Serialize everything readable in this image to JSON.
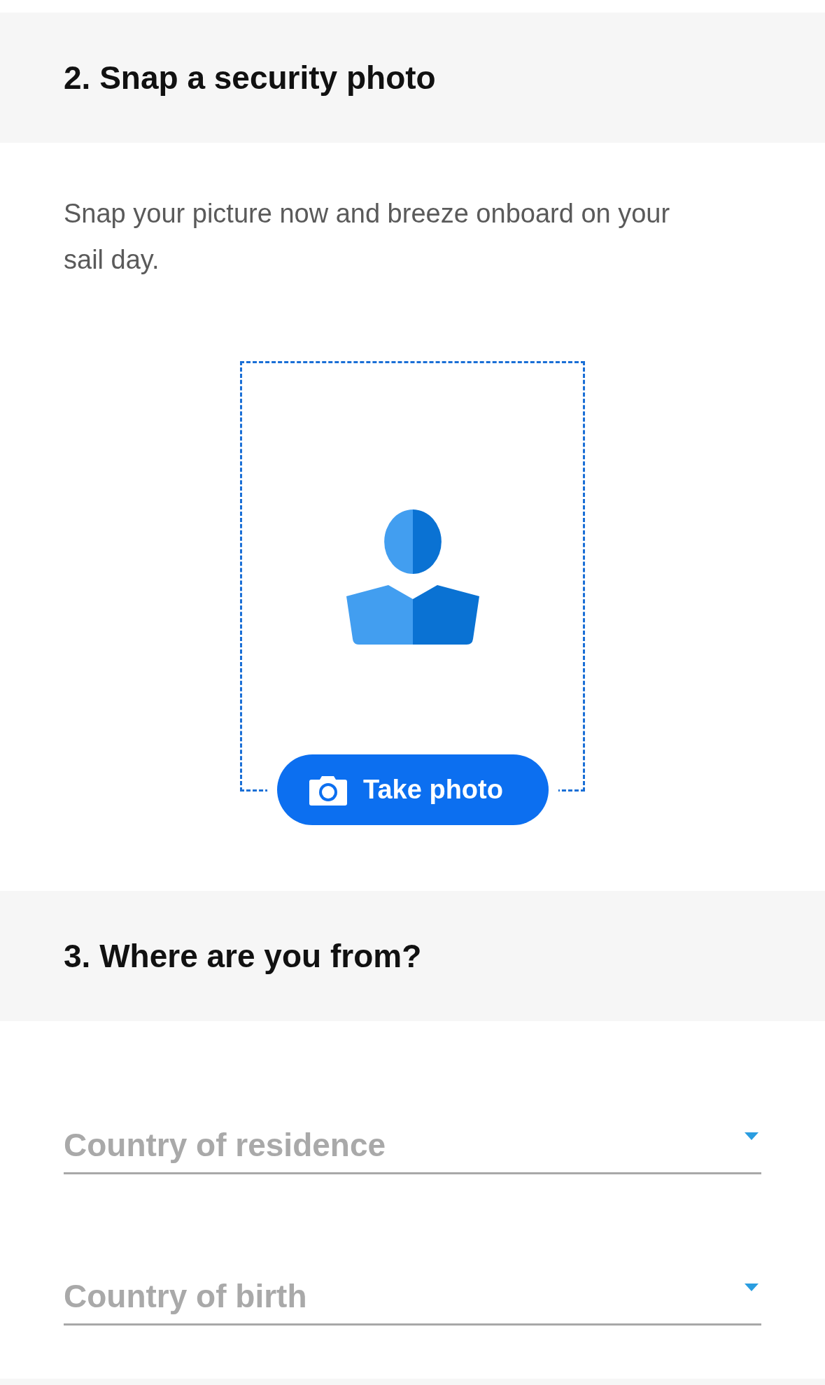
{
  "photo_section": {
    "heading": "2. Snap a security photo",
    "description": "Snap your picture now and breeze onboard on your sail day.",
    "button": "Take photo"
  },
  "origin_section": {
    "heading": "3. Where are you from?",
    "fields": [
      {
        "placeholder": "Country of residence"
      },
      {
        "placeholder": "Country of birth"
      }
    ]
  }
}
